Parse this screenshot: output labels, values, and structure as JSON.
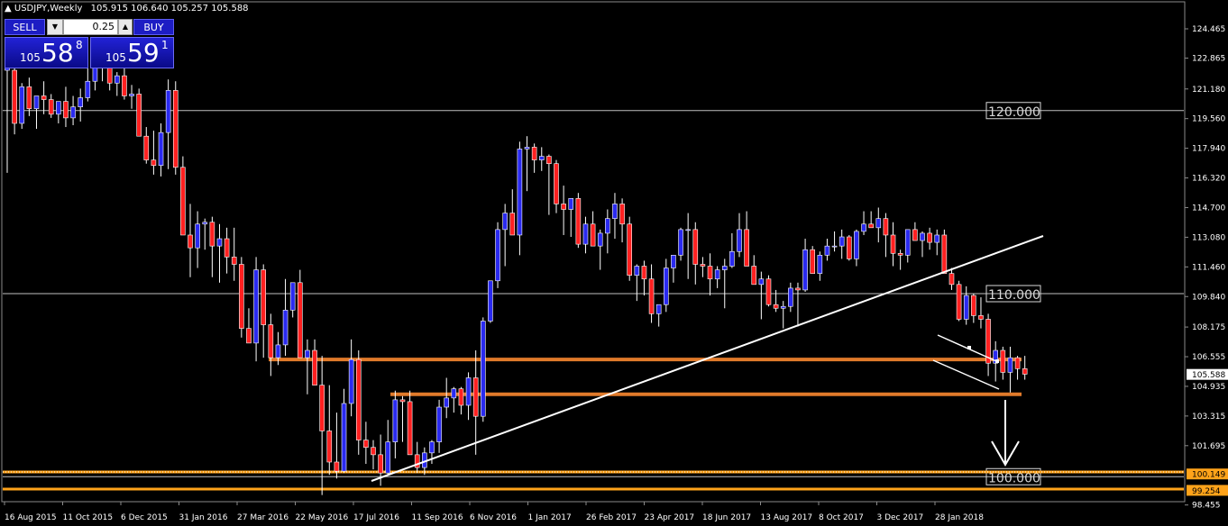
{
  "header": {
    "symbol_tf": "USDJPY,Weekly",
    "ohlc": "105.915 106.640 105.257 105.588"
  },
  "trade_panel": {
    "sell_label": "SELL",
    "buy_label": "BUY",
    "lot": "0.25",
    "sell_big_prefix": "105",
    "sell_digits": "58",
    "sell_sup": "8",
    "buy_big_prefix": "105",
    "buy_digits": "59",
    "buy_sup": "1"
  },
  "price_axis": [
    "124.465",
    "122.865",
    "121.180",
    "119.560",
    "117.940",
    "116.320",
    "114.700",
    "113.080",
    "111.460",
    "109.840",
    "108.175",
    "106.555",
    "104.935",
    "103.315",
    "101.695",
    "98.455"
  ],
  "price_tags": {
    "current": "105.588",
    "level_a": "100.149",
    "level_b": "99.254"
  },
  "date_axis": [
    "16 Aug 2015",
    "11 Oct 2015",
    "6 Dec 2015",
    "31 Jan 2016",
    "27 Mar 2016",
    "22 May 2016",
    "17 Jul 2016",
    "11 Sep 2016",
    "6 Nov 2016",
    "1 Jan 2017",
    "26 Feb 2017",
    "23 Apr 2017",
    "18 Jun 2017",
    "13 Aug 2017",
    "8 Oct 2017",
    "3 Dec 2017",
    "28 Jan 2018"
  ],
  "level_labels": [
    "120.000",
    "110.000",
    "100.000"
  ],
  "colors": {
    "bull": "#2a2af0",
    "bear": "#ff2020",
    "orange": "#e07a2a",
    "orange_line": "#ffa31a",
    "level_line": "#bfbfbf"
  },
  "chart_data": {
    "type": "candlestick",
    "title": "USDJPY,Weekly",
    "ylim": [
      98.455,
      124.465
    ],
    "horizontal_levels": [
      120.0,
      110.0,
      100.0
    ],
    "support_zones": [
      106.4,
      104.5
    ],
    "candles": [
      [
        122.2,
        122.9,
        116.6,
        122.6
      ],
      [
        122.2,
        122.5,
        118.7,
        119.3
      ],
      [
        119.3,
        121.5,
        119.0,
        121.3
      ],
      [
        121.3,
        121.8,
        119.7,
        120.1
      ],
      [
        120.1,
        120.5,
        119.0,
        120.8
      ],
      [
        120.8,
        121.6,
        119.8,
        120.6
      ],
      [
        120.6,
        120.9,
        119.6,
        119.8
      ],
      [
        119.8,
        120.4,
        119.3,
        120.5
      ],
      [
        120.5,
        121.3,
        119.1,
        119.6
      ],
      [
        119.6,
        120.8,
        119.2,
        120.2
      ],
      [
        120.2,
        121.2,
        119.4,
        120.7
      ],
      [
        120.7,
        123.6,
        120.5,
        121.6
      ],
      [
        121.6,
        122.9,
        121.1,
        123.2
      ],
      [
        123.2,
        123.7,
        121.6,
        122.8
      ],
      [
        122.8,
        123.8,
        121.1,
        121.5
      ],
      [
        121.5,
        122.1,
        120.8,
        121.9
      ],
      [
        121.9,
        122.3,
        120.6,
        120.8
      ],
      [
        120.8,
        121.4,
        120.1,
        120.9
      ],
      [
        120.9,
        121.2,
        119.1,
        118.6
      ],
      [
        118.6,
        119.1,
        117.1,
        117.3
      ],
      [
        117.3,
        118.9,
        116.5,
        117.0
      ],
      [
        117.0,
        119.3,
        116.4,
        118.8
      ],
      [
        118.8,
        121.7,
        116.8,
        121.1
      ],
      [
        121.1,
        121.6,
        116.5,
        116.9
      ],
      [
        116.9,
        117.5,
        114.2,
        113.2
      ],
      [
        113.2,
        114.9,
        110.9,
        112.5
      ],
      [
        112.5,
        114.5,
        111.4,
        113.8
      ],
      [
        113.8,
        114.1,
        112.4,
        113.9
      ],
      [
        113.9,
        114.2,
        110.9,
        112.6
      ],
      [
        112.6,
        113.8,
        110.6,
        113.0
      ],
      [
        113.0,
        113.6,
        111.1,
        112.0
      ],
      [
        112.0,
        113.6,
        110.7,
        111.6
      ],
      [
        111.6,
        112.0,
        107.6,
        108.1
      ],
      [
        108.1,
        109.2,
        107.7,
        107.3
      ],
      [
        107.3,
        112.0,
        106.3,
        111.3
      ],
      [
        111.3,
        111.6,
        106.5,
        108.3
      ],
      [
        108.3,
        108.9,
        105.5,
        106.5
      ],
      [
        106.5,
        107.9,
        106.1,
        107.2
      ],
      [
        107.2,
        110.8,
        106.6,
        109.1
      ],
      [
        109.1,
        110.5,
        108.7,
        110.6
      ],
      [
        110.6,
        111.3,
        108.0,
        106.5
      ],
      [
        106.5,
        107.5,
        104.5,
        106.9
      ],
      [
        106.9,
        107.5,
        105.5,
        105.0
      ],
      [
        105.0,
        106.6,
        99.0,
        102.5
      ],
      [
        102.5,
        105.0,
        100.1,
        100.8
      ],
      [
        100.8,
        103.5,
        99.9,
        100.3
      ],
      [
        100.3,
        104.8,
        100.2,
        104.0
      ],
      [
        104.0,
        107.5,
        103.3,
        106.4
      ],
      [
        106.4,
        106.9,
        101.2,
        102.0
      ],
      [
        102.0,
        103.0,
        100.7,
        101.6
      ],
      [
        101.6,
        102.0,
        100.4,
        101.2
      ],
      [
        101.2,
        102.3,
        99.5,
        100.2
      ],
      [
        100.2,
        103.1,
        100.1,
        101.9
      ],
      [
        101.9,
        104.7,
        101.0,
        104.2
      ],
      [
        104.2,
        104.4,
        101.9,
        104.1
      ],
      [
        104.1,
        104.7,
        102.5,
        101.2
      ],
      [
        101.2,
        101.9,
        100.2,
        100.5
      ],
      [
        100.5,
        101.6,
        100.1,
        101.3
      ],
      [
        101.3,
        102.0,
        100.7,
        101.9
      ],
      [
        101.9,
        104.2,
        101.3,
        103.8
      ],
      [
        103.8,
        105.4,
        103.2,
        104.3
      ],
      [
        104.3,
        104.9,
        103.5,
        104.8
      ],
      [
        104.8,
        104.9,
        103.4,
        103.9
      ],
      [
        103.9,
        105.7,
        103.1,
        105.4
      ],
      [
        105.4,
        106.9,
        101.2,
        103.3
      ],
      [
        103.3,
        108.7,
        103.0,
        108.5
      ],
      [
        108.5,
        110.0,
        108.4,
        110.7
      ],
      [
        110.7,
        113.9,
        110.3,
        113.5
      ],
      [
        113.5,
        114.9,
        111.5,
        114.4
      ],
      [
        114.4,
        115.7,
        113.2,
        113.2
      ],
      [
        113.2,
        118.3,
        112.1,
        117.9
      ],
      [
        117.9,
        118.6,
        115.6,
        118.0
      ],
      [
        118.0,
        118.2,
        116.6,
        117.3
      ],
      [
        117.3,
        118.0,
        116.7,
        117.5
      ],
      [
        117.5,
        117.6,
        114.3,
        117.1
      ],
      [
        117.1,
        117.3,
        114.4,
        114.9
      ],
      [
        114.9,
        115.9,
        113.2,
        114.6
      ],
      [
        114.6,
        115.1,
        113.1,
        115.2
      ],
      [
        115.2,
        115.5,
        112.5,
        112.7
      ],
      [
        112.7,
        114.2,
        112.2,
        113.8
      ],
      [
        113.8,
        114.5,
        112.8,
        112.6
      ],
      [
        112.6,
        113.5,
        111.3,
        113.3
      ],
      [
        113.3,
        114.6,
        112.2,
        114.1
      ],
      [
        114.1,
        115.5,
        113.0,
        114.9
      ],
      [
        114.9,
        115.2,
        112.8,
        113.8
      ],
      [
        113.8,
        114.2,
        110.7,
        111.0
      ],
      [
        111.0,
        111.6,
        109.6,
        111.5
      ],
      [
        111.5,
        111.8,
        109.9,
        110.8
      ],
      [
        110.8,
        111.6,
        108.4,
        108.9
      ],
      [
        108.9,
        109.4,
        108.2,
        109.4
      ],
      [
        109.4,
        111.9,
        109.0,
        111.4
      ],
      [
        111.4,
        112.0,
        110.6,
        112.1
      ],
      [
        112.1,
        113.6,
        111.8,
        113.5
      ],
      [
        113.5,
        114.4,
        110.8,
        113.5
      ],
      [
        113.5,
        113.9,
        110.5,
        111.6
      ],
      [
        111.6,
        112.0,
        110.9,
        111.5
      ],
      [
        111.5,
        112.2,
        109.9,
        110.8
      ],
      [
        110.8,
        111.5,
        110.3,
        111.3
      ],
      [
        111.3,
        111.9,
        109.2,
        111.5
      ],
      [
        111.5,
        113.3,
        111.4,
        112.3
      ],
      [
        112.3,
        114.4,
        112.0,
        113.5
      ],
      [
        113.5,
        114.5,
        112.2,
        111.5
      ],
      [
        111.5,
        112.1,
        110.6,
        110.5
      ],
      [
        110.5,
        111.2,
        108.6,
        110.8
      ],
      [
        110.8,
        111.0,
        109.3,
        109.4
      ],
      [
        109.4,
        110.2,
        109.0,
        109.2
      ],
      [
        109.2,
        109.6,
        108.1,
        109.3
      ],
      [
        109.3,
        110.6,
        109.0,
        110.3
      ],
      [
        110.3,
        110.6,
        108.2,
        110.2
      ],
      [
        110.2,
        113.0,
        110.1,
        112.4
      ],
      [
        112.4,
        112.6,
        111.7,
        111.1
      ],
      [
        111.1,
        112.3,
        110.7,
        112.1
      ],
      [
        112.1,
        113.0,
        111.8,
        112.6
      ],
      [
        112.6,
        113.4,
        112.3,
        112.6
      ],
      [
        112.6,
        113.5,
        111.9,
        113.1
      ],
      [
        113.1,
        113.2,
        111.8,
        111.9
      ],
      [
        111.9,
        113.5,
        111.5,
        113.4
      ],
      [
        113.4,
        114.5,
        113.2,
        113.8
      ],
      [
        113.8,
        114.5,
        113.6,
        113.6
      ],
      [
        113.6,
        114.7,
        112.8,
        114.1
      ],
      [
        114.1,
        114.4,
        112.0,
        113.2
      ],
      [
        113.2,
        113.9,
        111.5,
        112.2
      ],
      [
        112.2,
        112.4,
        111.3,
        112.1
      ],
      [
        112.1,
        113.4,
        111.7,
        113.5
      ],
      [
        113.5,
        113.9,
        112.9,
        112.9
      ],
      [
        112.9,
        113.4,
        112.0,
        113.3
      ],
      [
        113.3,
        113.6,
        112.4,
        112.8
      ],
      [
        112.8,
        113.5,
        112.1,
        113.2
      ],
      [
        113.2,
        113.5,
        111.3,
        111.1
      ],
      [
        111.1,
        111.4,
        110.2,
        110.5
      ],
      [
        110.5,
        110.7,
        108.5,
        108.6
      ],
      [
        108.6,
        110.4,
        108.3,
        109.9
      ],
      [
        109.9,
        110.0,
        108.4,
        108.8
      ],
      [
        108.8,
        109.8,
        108.1,
        108.6
      ],
      [
        108.6,
        108.9,
        105.5,
        106.2
      ],
      [
        106.2,
        107.4,
        105.2,
        106.9
      ],
      [
        106.9,
        107.1,
        105.3,
        105.7
      ],
      [
        105.7,
        107.1,
        104.6,
        106.5
      ],
      [
        106.5,
        106.6,
        105.3,
        105.9
      ],
      [
        105.9,
        106.6,
        105.3,
        105.6
      ]
    ]
  }
}
